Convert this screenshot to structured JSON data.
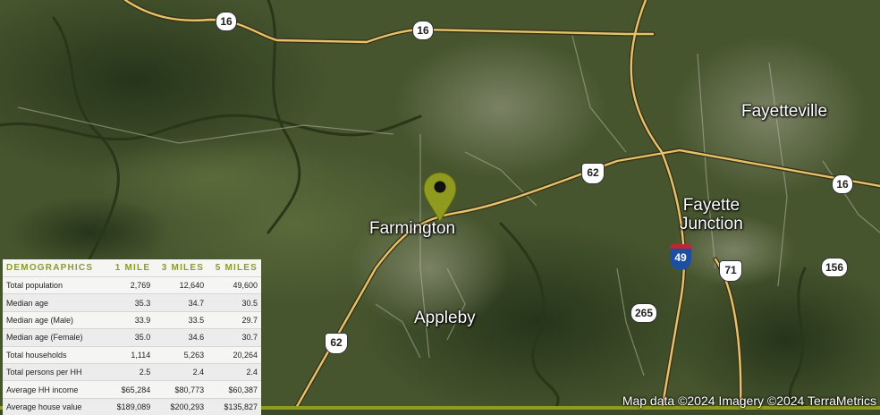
{
  "map": {
    "cities": [
      {
        "id": "fayetteville",
        "name": "Fayetteville"
      },
      {
        "id": "fayette-junction",
        "name": "Fayette\nJunction"
      },
      {
        "id": "farmington",
        "name": "Farmington"
      },
      {
        "id": "appleby",
        "name": "Appleby"
      }
    ],
    "shields": [
      {
        "id": "sr16-west",
        "route": "16",
        "kind": "state"
      },
      {
        "id": "sr16-north",
        "route": "16",
        "kind": "state"
      },
      {
        "id": "sr16-east",
        "route": "16",
        "kind": "state"
      },
      {
        "id": "us62-east",
        "route": "62",
        "kind": "us"
      },
      {
        "id": "us62-south",
        "route": "62",
        "kind": "us"
      },
      {
        "id": "i49",
        "route": "49",
        "kind": "interstate"
      },
      {
        "id": "us71",
        "route": "71",
        "kind": "us"
      },
      {
        "id": "sr156",
        "route": "156",
        "kind": "state"
      },
      {
        "id": "sr265",
        "route": "265",
        "kind": "state"
      }
    ],
    "marker_color": "#8f9a1f",
    "attribution": "Map data ©2024 Imagery ©2024 TerraMetrics"
  },
  "demographics": {
    "headers": [
      "DEMOGRAPHICS",
      "1 MILE",
      "3 MILES",
      "5 MILES"
    ],
    "rows": [
      [
        "Total population",
        "2,769",
        "12,640",
        "49,600"
      ],
      [
        "Median age",
        "35.3",
        "34.7",
        "30.5"
      ],
      [
        "Median age (Male)",
        "33.9",
        "33.5",
        "29.7"
      ],
      [
        "Median age (Female)",
        "35.0",
        "34.6",
        "30.7"
      ],
      [
        "Total households",
        "1,114",
        "5,263",
        "20,264"
      ],
      [
        "Total persons per HH",
        "2.5",
        "2.4",
        "2.4"
      ],
      [
        "Average HH income",
        "$65,284",
        "$80,773",
        "$60,387"
      ],
      [
        "Average house value",
        "$189,089",
        "$200,293",
        "$135,827"
      ]
    ]
  }
}
